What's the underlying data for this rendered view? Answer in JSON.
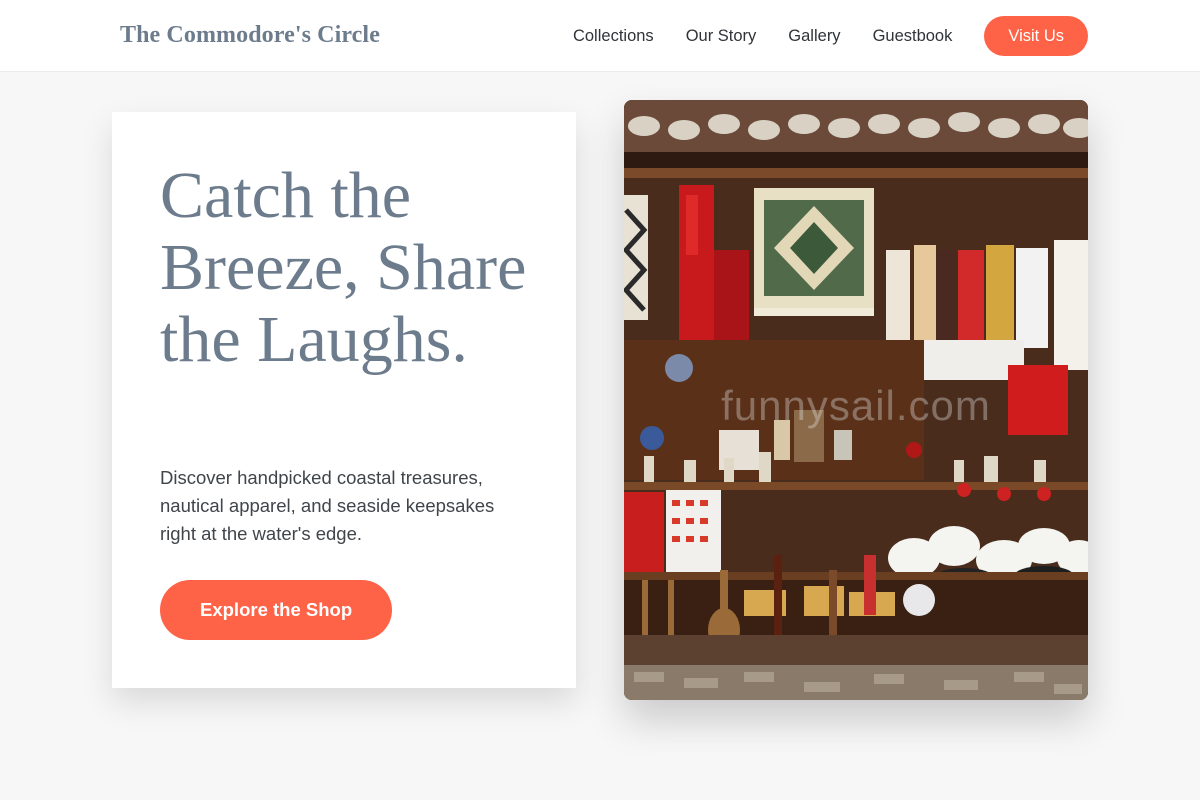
{
  "header": {
    "brand": "The Commodore's Circle",
    "nav": [
      "Collections",
      "Our Story",
      "Gallery",
      "Guestbook"
    ],
    "cta_label": "Visit Us"
  },
  "hero": {
    "headline": "Catch the Breeze, Share the Laughs.",
    "subtext": "Discover handpicked coastal treasures, nautical apparel, and seaside keepsakes right at the water's edge.",
    "button_label": "Explore the Shop",
    "image": {
      "subject": "market stall with hanging textiles, rugs, souvenirs and white felt hats",
      "watermark": "funnysail.com"
    }
  },
  "colors": {
    "accent": "#ff6347",
    "brand_text": "#6d7c8c",
    "page_bg": "#f7f7f7",
    "card_bg": "#ffffff"
  }
}
